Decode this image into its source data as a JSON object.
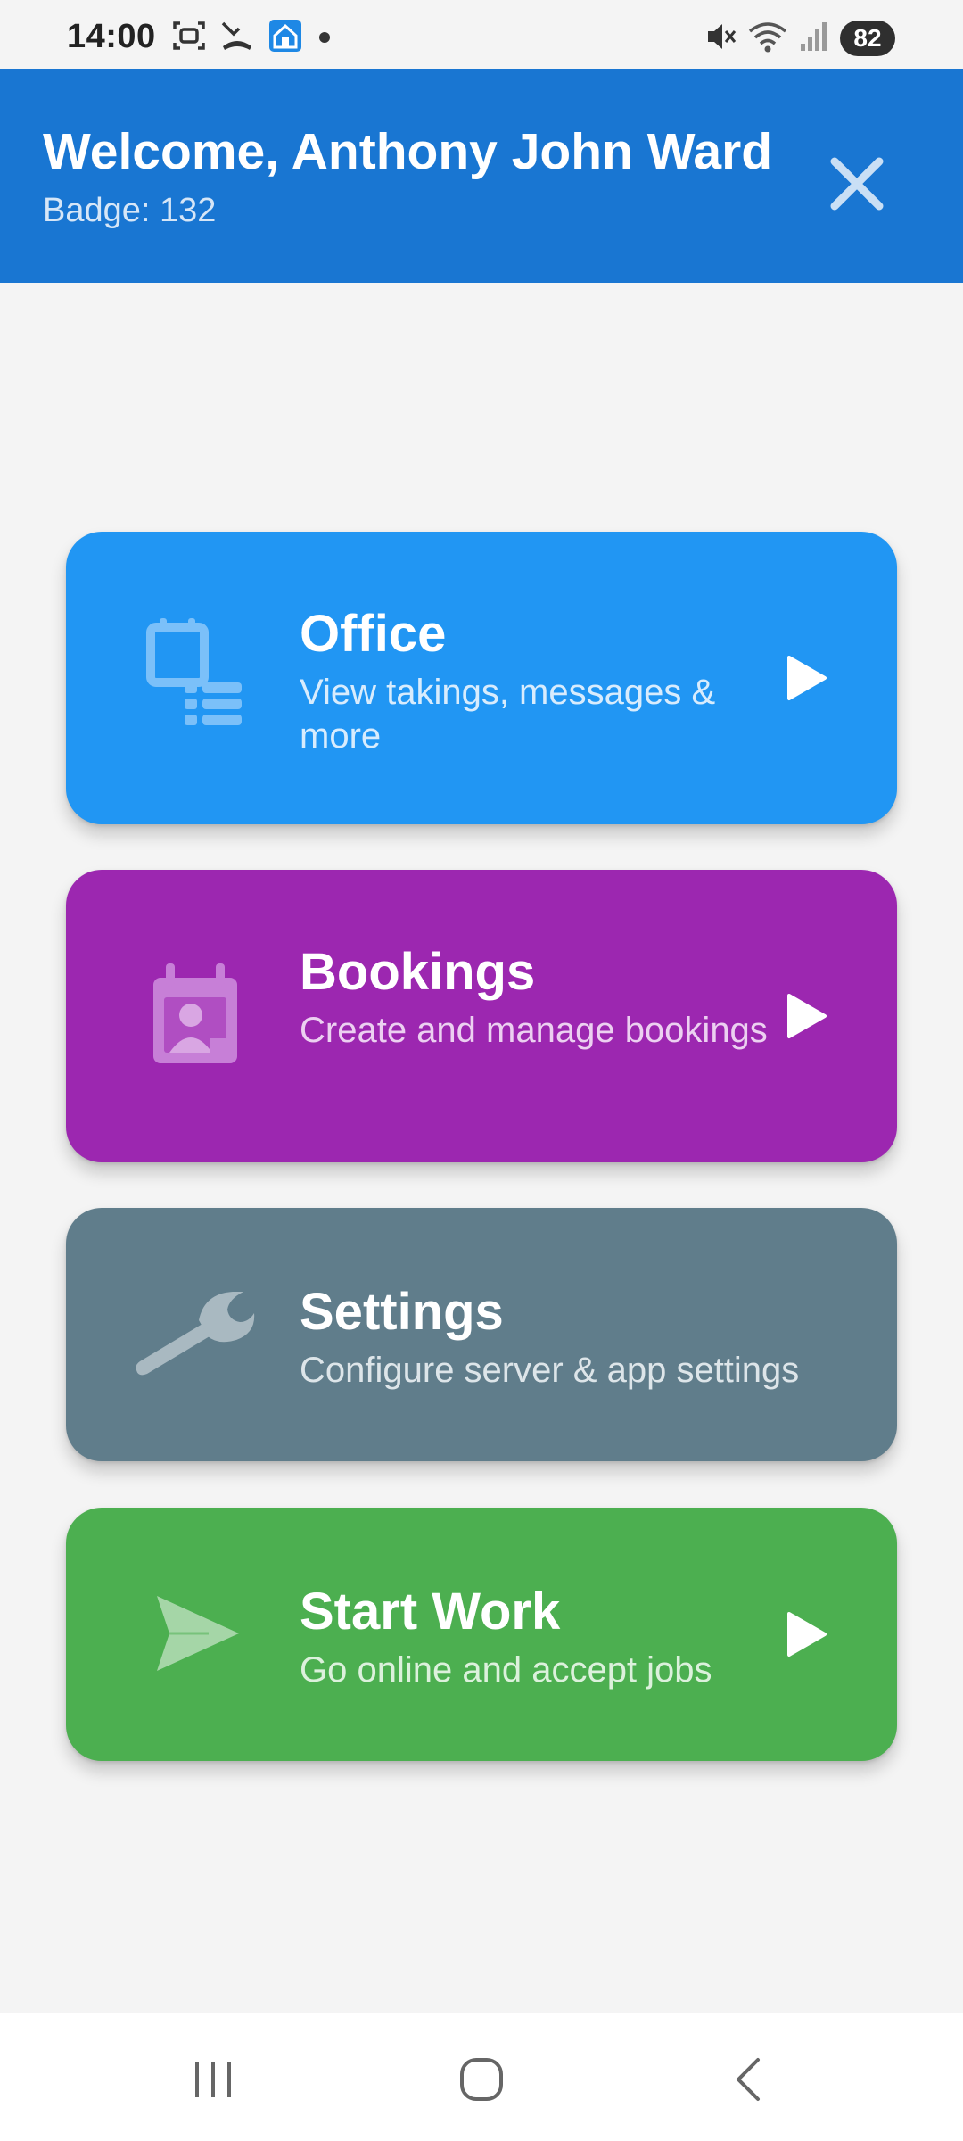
{
  "status_bar": {
    "time": "14:00",
    "left_icons": [
      "screenshot-icon",
      "missed-call-icon",
      "home-app-icon",
      "notification-dot-icon"
    ],
    "right_icons": [
      "mute-icon",
      "wifi-icon",
      "signal-icon"
    ],
    "battery": "82"
  },
  "header": {
    "title": "Welcome, Anthony John Ward",
    "subtitle": "Badge: 132",
    "close_icon": "close-icon",
    "background": "#1976d2"
  },
  "menu": [
    {
      "title": "Office",
      "description": "View takings, messages & more",
      "icon": "office-icon",
      "color": "#2196f3",
      "desc_color": "#d8ecfd"
    },
    {
      "title": "Bookings",
      "description": "Create and manage bookings",
      "icon": "bookings-calendar-icon",
      "color": "#9c27b0",
      "desc_color": "#ecd0f1"
    },
    {
      "title": "Settings",
      "description": "Configure server & app settings",
      "icon": "wrench-icon",
      "color": "#607d8b",
      "desc_color": "#dde5e9"
    },
    {
      "title": "Start Work",
      "description": "Go online and accept jobs",
      "icon": "send-icon",
      "color": "#4caf50",
      "desc_color": "#dcf1dc"
    }
  ],
  "nav_bar": {
    "buttons": [
      "recents-icon",
      "home-icon",
      "back-icon"
    ]
  }
}
